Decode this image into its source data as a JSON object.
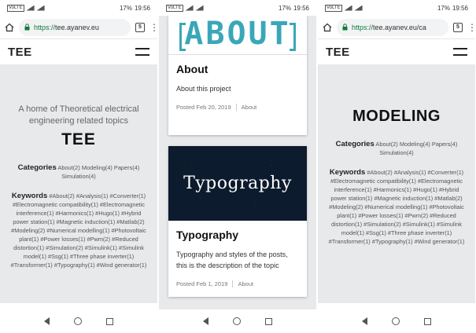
{
  "statusbar": {
    "carrier_left": "VoLTE",
    "battery": "17%",
    "time": "19:56"
  },
  "screen1": {
    "url_scheme": "https://",
    "url_host": "tee.ayanev.eu",
    "tab_count": "5",
    "logo": "TEE",
    "tagline": "A home of Theoretical electrical engineering related topics",
    "title": "TEE",
    "categories_label": "Categories",
    "categories": [
      "About(2)",
      "Modeling(4)",
      "Papers(4)",
      "Simulation(4)"
    ],
    "keywords_label": "Keywords",
    "keywords": [
      "#About(2)",
      "#Analysis(1)",
      "#Converter(1)",
      "#Electromagnetic compatibility(1)",
      "#Electromagnetic interference(1)",
      "#Harmonics(1)",
      "#Hugo(1)",
      "#Hybrid power station(1)",
      "#Magnetic induction(1)",
      "#Matlab(2)",
      "#Modeling(2)",
      "#Numerical modelling(1)",
      "#Photovoltaic plant(1)",
      "#Power losses(1)",
      "#Pwm(2)",
      "#Reduced distortion(1)",
      "#Simulation(2)",
      "#Simulink(1)",
      "#Simulink model(1)",
      "#Ssg(1)",
      "#Three phase inverter(1)",
      "#Transformer(1)",
      "#Typography(1)",
      "#Wind generator(1)"
    ]
  },
  "screen2": {
    "cards": [
      {
        "image_text": "ABOUT",
        "title": "About",
        "desc": "About this project",
        "date": "Posted Feb 20, 2019",
        "category": "About"
      },
      {
        "image_text": "Typography",
        "title": "Typography",
        "desc": "Typography and styles of the posts, this is the description of the topic",
        "date": "Posted Feb 1, 2019",
        "category": "About"
      }
    ]
  },
  "screen3": {
    "url_scheme": "https://",
    "url_host": "tee.ayanev.eu/ca",
    "tab_count": "5",
    "logo": "TEE",
    "title": "MODELING",
    "categories_label": "Categories",
    "categories": [
      "About(2)",
      "Modeling(4)",
      "Papers(4)",
      "Simulation(4)"
    ],
    "keywords_label": "Keywords",
    "keywords": [
      "#About(2)",
      "#Analysis(1)",
      "#Converter(1)",
      "#Electromagnetic compatibility(1)",
      "#Electromagnetic interference(1)",
      "#Harmonics(1)",
      "#Hugo(1)",
      "#Hybrid power station(1)",
      "#Magnetic induction(1)",
      "#Matlab(2)",
      "#Modeling(2)",
      "#Numerical modelling(1)",
      "#Photovoltaic plant(1)",
      "#Power losses(1)",
      "#Pwm(2)",
      "#Reduced distortion(1)",
      "#Simulation(2)",
      "#Simulink(1)",
      "#Simulink model(1)",
      "#Ssg(1)",
      "#Three phase inverter(1)",
      "#Transformer(1)",
      "#Typography(1)",
      "#Wind generator(1)"
    ]
  },
  "icons": [
    "home-icon",
    "lock-icon",
    "menu-dots-icon",
    "hamburger-icon",
    "back-icon",
    "home-circle-icon",
    "recents-icon"
  ],
  "colors": {
    "accent_teal": "#3aa7b8",
    "url_green": "#0f7b3b",
    "page_grey": "#e8e9eb",
    "typo_bg": "#0d1b2e"
  }
}
